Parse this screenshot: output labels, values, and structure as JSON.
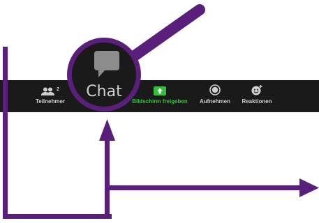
{
  "toolbar": {
    "participants": {
      "label": "Teilnehmer",
      "count": "2",
      "icon": "participants-icon"
    },
    "chat": {
      "label": "Chat",
      "icon": "chat-bubble-icon"
    },
    "share": {
      "label": "Bildschirm freigeben",
      "icon": "share-screen-icon",
      "color": "#34c03b"
    },
    "record": {
      "label": "Aufnehmen",
      "icon": "record-icon"
    },
    "reactions": {
      "label": "Reaktionen",
      "icon": "reaction-smiley-icon"
    }
  },
  "colors": {
    "toolbar_bg": "#1a1a1a",
    "annotation": "#5a1f7a",
    "share_accent": "#34c03b"
  }
}
